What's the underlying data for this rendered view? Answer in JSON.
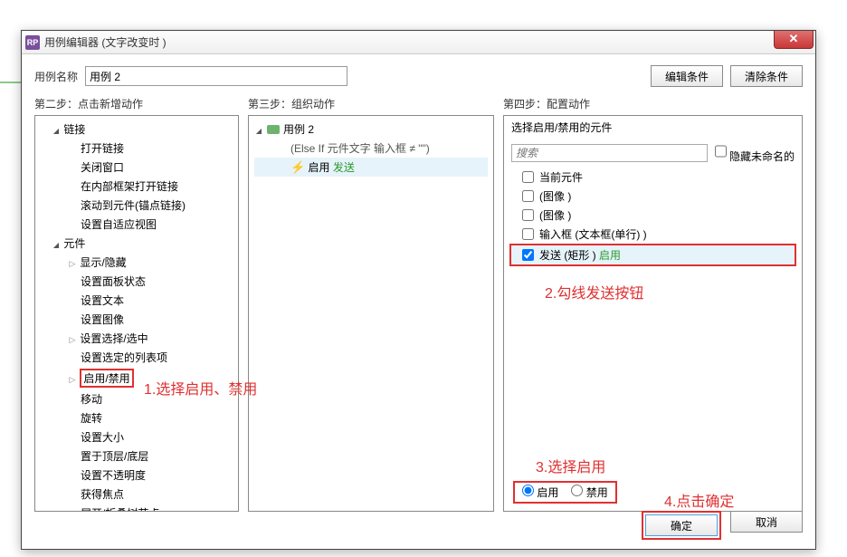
{
  "title": "用例编辑器 (文字改变时  )",
  "name_label": "用例名称",
  "name_value": "用例 2",
  "edit_cond": "编辑条件",
  "clear_cond": "清除条件",
  "step1": "第二步：点击新增动作",
  "step2": "第三步：组织动作",
  "step3": "第四步：配置动作",
  "tree": {
    "link_group": "链接",
    "link_items": [
      "打开链接",
      "关闭窗口",
      "在内部框架打开链接",
      "滚动到元件(锚点链接)",
      "设置自适应视图"
    ],
    "widget_group": "元件",
    "widget_items_expand": [
      "显示/隐藏"
    ],
    "widget_items_plain": [
      "设置面板状态",
      "设置文本",
      "设置图像"
    ],
    "widget_items_expand2": [
      "设置选择/选中"
    ],
    "widget_items_plain2": [
      "设置选定的列表项"
    ],
    "enable_disable": "启用/禁用",
    "widget_items_plain3": [
      "移动",
      "旋转",
      "设置大小",
      "置于顶层/底层",
      "设置不透明度",
      "获得焦点",
      "展开/折叠树节点"
    ]
  },
  "p2": {
    "case": "用例 2",
    "cond": "(Else If 元件文字 输入框 ≠ \"\")",
    "action_prefix": "启用",
    "action_target": "发送"
  },
  "p3": {
    "header": "选择启用/禁用的元件",
    "search_ph": "搜索",
    "hide_unnamed": "隐藏未命名的",
    "items": [
      {
        "label": "当前元件",
        "checked": false
      },
      {
        "label": "(图像 )",
        "checked": false
      },
      {
        "label": "(图像 )",
        "checked": false
      },
      {
        "label": "输入框 (文本框(单行) )",
        "checked": false
      }
    ],
    "sel_item": {
      "label": "发送 (矩形 )",
      "state": "启用",
      "checked": true
    },
    "radio_enable": "启用",
    "radio_disable": "禁用"
  },
  "ann": {
    "a1": "1.选择启用、禁用",
    "a2": "2.勾线发送按钮",
    "a3": "3.选择启用",
    "a4": "4.点击确定"
  },
  "ok": "确定",
  "cancel": "取消"
}
